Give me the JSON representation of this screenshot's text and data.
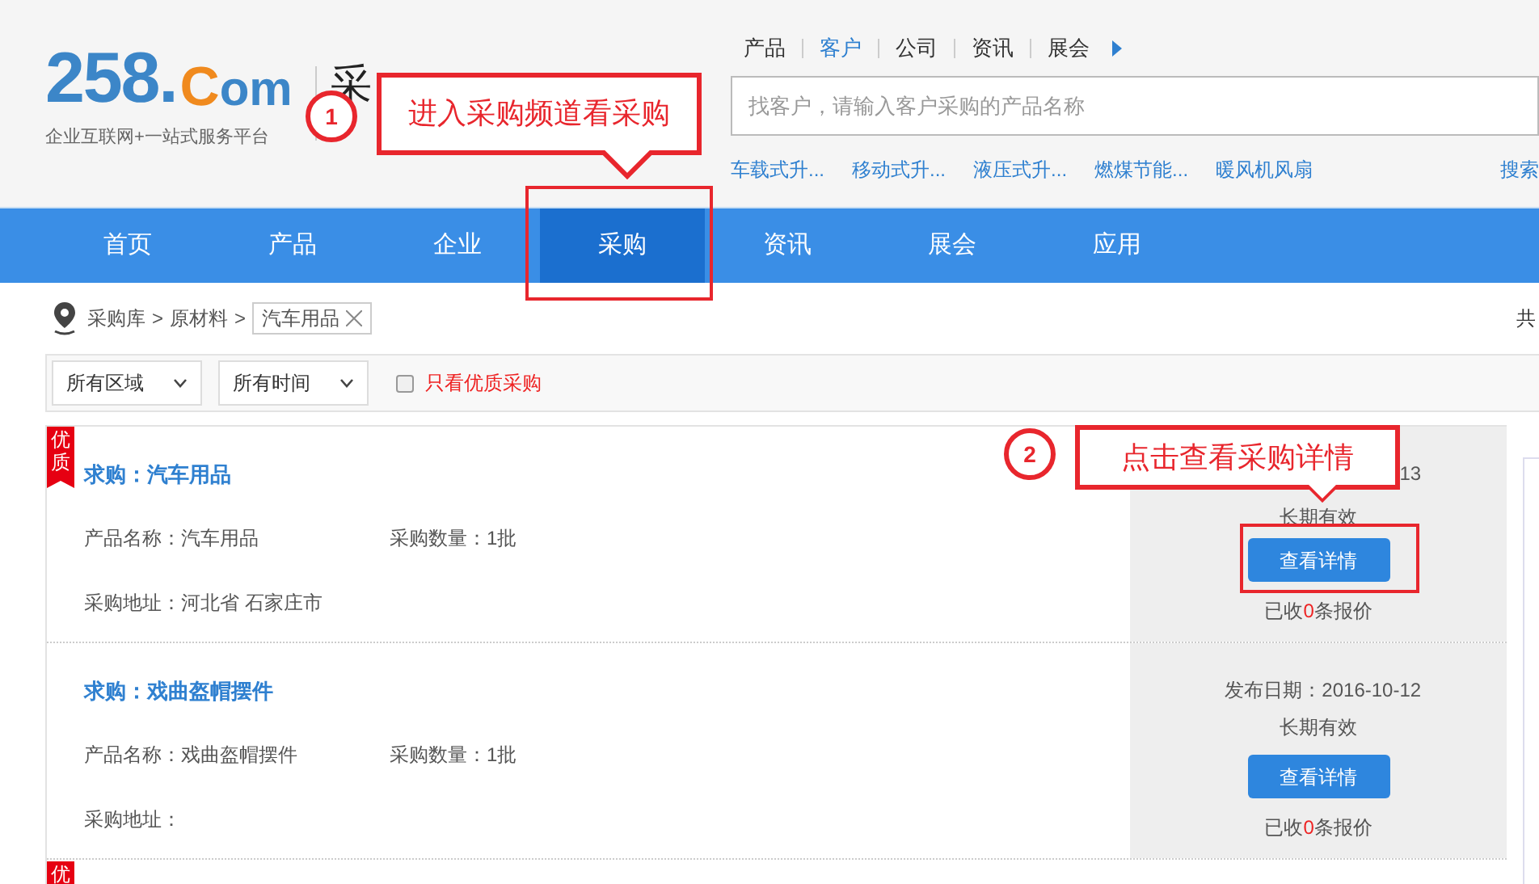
{
  "logo": {
    "number": "258.",
    "c": "C",
    "rest": "om",
    "tagline": "企业互联网+一站式服务平台"
  },
  "channel_title": "采",
  "search_tabs": [
    {
      "label": "产品",
      "selected": false
    },
    {
      "label": "客户",
      "selected": true
    },
    {
      "label": "公司",
      "selected": false
    },
    {
      "label": "资讯",
      "selected": false
    },
    {
      "label": "展会",
      "selected": false
    }
  ],
  "search": {
    "placeholder": "找客户，请输入客户采购的产品名称"
  },
  "hot_keywords": [
    "车载式升...",
    "移动式升...",
    "液压式升...",
    "燃煤节能...",
    "暖风机风扇"
  ],
  "search_tip": "搜索",
  "nav": [
    {
      "label": "首页",
      "selected": false
    },
    {
      "label": "产品",
      "selected": false
    },
    {
      "label": "企业",
      "selected": false
    },
    {
      "label": "采购",
      "selected": true
    },
    {
      "label": "资讯",
      "selected": false
    },
    {
      "label": "展会",
      "selected": false
    },
    {
      "label": "应用",
      "selected": false
    }
  ],
  "breadcrumb": {
    "items": [
      "采购库",
      "原材料"
    ],
    "separator": ">",
    "current": "汽车用品",
    "total_label": "共"
  },
  "filters": {
    "selects": [
      "所有区域",
      "所有时间"
    ],
    "premium_only": {
      "label": "只看优质采购",
      "checked": false
    }
  },
  "listings": [
    {
      "badge": "优质",
      "title": "求购：汽车用品",
      "product": "产品名称：汽车用品",
      "quantity": "采购数量：1批",
      "address": "采购地址：河北省 石家庄市",
      "date": "13",
      "validity": "长期有效",
      "button": "查看详情",
      "quotes": {
        "before": "已收",
        "count": "0",
        "after": "条报价"
      }
    },
    {
      "title": "求购：戏曲盔帽摆件",
      "product": "产品名称：戏曲盔帽摆件",
      "quantity": "采购数量：1批",
      "address": "采购地址：",
      "date": "发布日期：2016-10-12",
      "validity": "长期有效",
      "button": "查看详情",
      "quotes": {
        "before": "已收",
        "count": "0",
        "after": "条报价"
      }
    }
  ],
  "next_listing_badge": "优",
  "annotations": [
    {
      "number": "1",
      "text": "进入采购频道看采购"
    },
    {
      "number": "2",
      "text": "点击查看采购详情"
    }
  ]
}
